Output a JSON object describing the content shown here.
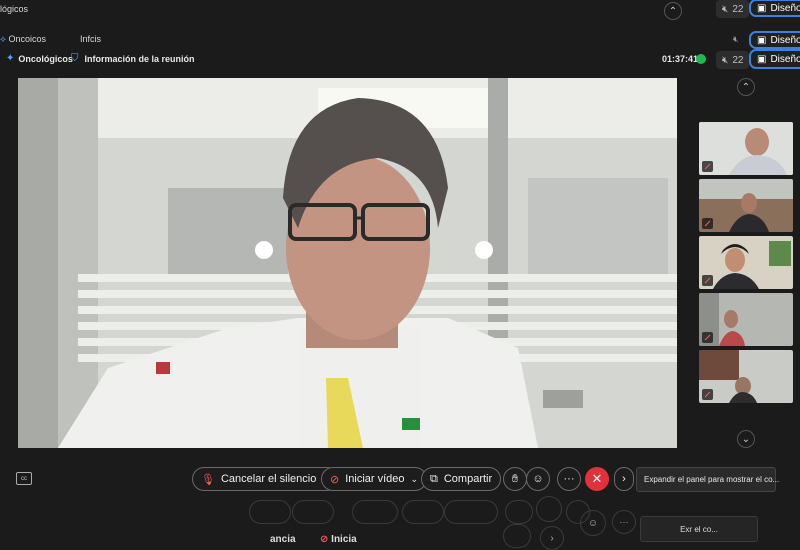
{
  "topbar1": {
    "title_fragment": "lógicos",
    "participant_count": "22",
    "layout_label": "Diseño"
  },
  "topbar2": {
    "item1": "Oncoicos",
    "item2": "Infcis",
    "layout_label": "Diseño"
  },
  "meeting_header": {
    "org_name": "Oncológicos",
    "meeting_info": "Información de la reunión",
    "time": "01:37:41",
    "participant_count": "22",
    "layout_label": "Diseño"
  },
  "controls": {
    "unmute_label": "Cancelar el silencio",
    "start_video_label": "Iniciar vídeo",
    "share_label": "Compartir",
    "more_icon": "···",
    "expand_tooltip": "Expandir el panel para mostrar el co..."
  },
  "ghost_controls": {
    "tooltip": "Exr el co...",
    "label1": "ancia",
    "label2": "Inicia"
  },
  "colors": {
    "accent": "#3d7fd9",
    "leave_red": "#e0323a",
    "background": "#1b1b1b",
    "status_green": "#1fb851"
  },
  "icons": [
    "microphone-off-icon",
    "video-off-icon",
    "share-screen-icon",
    "hand-raise-icon",
    "reaction-icon",
    "more-icon",
    "end-call-icon",
    "chevron-right-icon",
    "chevron-up-icon",
    "chevron-down-icon",
    "caption-icon",
    "shield-icon",
    "layout-icon"
  ]
}
